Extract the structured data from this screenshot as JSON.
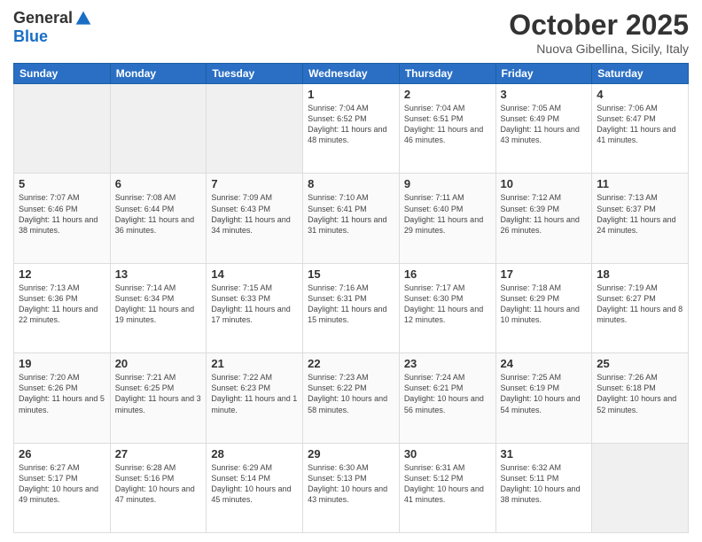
{
  "header": {
    "logo_general": "General",
    "logo_blue": "Blue",
    "month_title": "October 2025",
    "location": "Nuova Gibellina, Sicily, Italy"
  },
  "days_of_week": [
    "Sunday",
    "Monday",
    "Tuesday",
    "Wednesday",
    "Thursday",
    "Friday",
    "Saturday"
  ],
  "weeks": [
    [
      {
        "day": "",
        "info": ""
      },
      {
        "day": "",
        "info": ""
      },
      {
        "day": "",
        "info": ""
      },
      {
        "day": "1",
        "info": "Sunrise: 7:04 AM\nSunset: 6:52 PM\nDaylight: 11 hours and 48 minutes."
      },
      {
        "day": "2",
        "info": "Sunrise: 7:04 AM\nSunset: 6:51 PM\nDaylight: 11 hours and 46 minutes."
      },
      {
        "day": "3",
        "info": "Sunrise: 7:05 AM\nSunset: 6:49 PM\nDaylight: 11 hours and 43 minutes."
      },
      {
        "day": "4",
        "info": "Sunrise: 7:06 AM\nSunset: 6:47 PM\nDaylight: 11 hours and 41 minutes."
      }
    ],
    [
      {
        "day": "5",
        "info": "Sunrise: 7:07 AM\nSunset: 6:46 PM\nDaylight: 11 hours and 38 minutes."
      },
      {
        "day": "6",
        "info": "Sunrise: 7:08 AM\nSunset: 6:44 PM\nDaylight: 11 hours and 36 minutes."
      },
      {
        "day": "7",
        "info": "Sunrise: 7:09 AM\nSunset: 6:43 PM\nDaylight: 11 hours and 34 minutes."
      },
      {
        "day": "8",
        "info": "Sunrise: 7:10 AM\nSunset: 6:41 PM\nDaylight: 11 hours and 31 minutes."
      },
      {
        "day": "9",
        "info": "Sunrise: 7:11 AM\nSunset: 6:40 PM\nDaylight: 11 hours and 29 minutes."
      },
      {
        "day": "10",
        "info": "Sunrise: 7:12 AM\nSunset: 6:39 PM\nDaylight: 11 hours and 26 minutes."
      },
      {
        "day": "11",
        "info": "Sunrise: 7:13 AM\nSunset: 6:37 PM\nDaylight: 11 hours and 24 minutes."
      }
    ],
    [
      {
        "day": "12",
        "info": "Sunrise: 7:13 AM\nSunset: 6:36 PM\nDaylight: 11 hours and 22 minutes."
      },
      {
        "day": "13",
        "info": "Sunrise: 7:14 AM\nSunset: 6:34 PM\nDaylight: 11 hours and 19 minutes."
      },
      {
        "day": "14",
        "info": "Sunrise: 7:15 AM\nSunset: 6:33 PM\nDaylight: 11 hours and 17 minutes."
      },
      {
        "day": "15",
        "info": "Sunrise: 7:16 AM\nSunset: 6:31 PM\nDaylight: 11 hours and 15 minutes."
      },
      {
        "day": "16",
        "info": "Sunrise: 7:17 AM\nSunset: 6:30 PM\nDaylight: 11 hours and 12 minutes."
      },
      {
        "day": "17",
        "info": "Sunrise: 7:18 AM\nSunset: 6:29 PM\nDaylight: 11 hours and 10 minutes."
      },
      {
        "day": "18",
        "info": "Sunrise: 7:19 AM\nSunset: 6:27 PM\nDaylight: 11 hours and 8 minutes."
      }
    ],
    [
      {
        "day": "19",
        "info": "Sunrise: 7:20 AM\nSunset: 6:26 PM\nDaylight: 11 hours and 5 minutes."
      },
      {
        "day": "20",
        "info": "Sunrise: 7:21 AM\nSunset: 6:25 PM\nDaylight: 11 hours and 3 minutes."
      },
      {
        "day": "21",
        "info": "Sunrise: 7:22 AM\nSunset: 6:23 PM\nDaylight: 11 hours and 1 minute."
      },
      {
        "day": "22",
        "info": "Sunrise: 7:23 AM\nSunset: 6:22 PM\nDaylight: 10 hours and 58 minutes."
      },
      {
        "day": "23",
        "info": "Sunrise: 7:24 AM\nSunset: 6:21 PM\nDaylight: 10 hours and 56 minutes."
      },
      {
        "day": "24",
        "info": "Sunrise: 7:25 AM\nSunset: 6:19 PM\nDaylight: 10 hours and 54 minutes."
      },
      {
        "day": "25",
        "info": "Sunrise: 7:26 AM\nSunset: 6:18 PM\nDaylight: 10 hours and 52 minutes."
      }
    ],
    [
      {
        "day": "26",
        "info": "Sunrise: 6:27 AM\nSunset: 5:17 PM\nDaylight: 10 hours and 49 minutes."
      },
      {
        "day": "27",
        "info": "Sunrise: 6:28 AM\nSunset: 5:16 PM\nDaylight: 10 hours and 47 minutes."
      },
      {
        "day": "28",
        "info": "Sunrise: 6:29 AM\nSunset: 5:14 PM\nDaylight: 10 hours and 45 minutes."
      },
      {
        "day": "29",
        "info": "Sunrise: 6:30 AM\nSunset: 5:13 PM\nDaylight: 10 hours and 43 minutes."
      },
      {
        "day": "30",
        "info": "Sunrise: 6:31 AM\nSunset: 5:12 PM\nDaylight: 10 hours and 41 minutes."
      },
      {
        "day": "31",
        "info": "Sunrise: 6:32 AM\nSunset: 5:11 PM\nDaylight: 10 hours and 38 minutes."
      },
      {
        "day": "",
        "info": ""
      }
    ]
  ]
}
